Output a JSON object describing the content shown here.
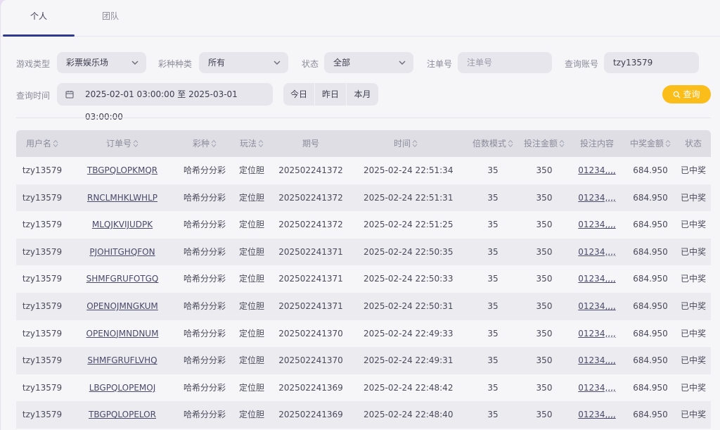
{
  "tabs": [
    {
      "label": "个人"
    },
    {
      "label": "团队"
    }
  ],
  "filters": {
    "game_type_label": "游戏类型",
    "game_type_value": "彩票娱乐场",
    "lottery_type_label": "彩种种类",
    "lottery_type_value": "所有",
    "status_label": "状态",
    "status_value": "全部",
    "order_label": "注单号",
    "order_placeholder": "注单号",
    "account_label": "查询账号",
    "account_value": "tzy13579",
    "time_label": "查询时间",
    "date_range": "2025-02-01 03:00:00 至 2025-03-01 03:00:00",
    "quick_ranges": [
      "今日",
      "昨日",
      "本月"
    ],
    "query_button": "查询"
  },
  "table": {
    "headers": [
      "用户名",
      "订单号",
      "彩种",
      "玩法",
      "期号",
      "时间",
      "倍数模式",
      "投注金额",
      "投注内容",
      "中奖金额",
      "状态"
    ],
    "rows": [
      [
        "tzy13579",
        "TBGPQLOPKMQR",
        "哈希分分彩",
        "定位胆",
        "202502241372",
        "2025-02-24 22:51:34",
        "35",
        "350",
        "01234,,,,",
        "684.950",
        "已中奖"
      ],
      [
        "tzy13579",
        "RNCLMHKLWHLP",
        "哈希分分彩",
        "定位胆",
        "202502241372",
        "2025-02-24 22:51:31",
        "35",
        "350",
        "01234,,,,",
        "684.950",
        "已中奖"
      ],
      [
        "tzy13579",
        "MLQJKVIJUDPK",
        "哈希分分彩",
        "定位胆",
        "202502241372",
        "2025-02-24 22:51:25",
        "35",
        "350",
        "01234,,,,",
        "684.950",
        "已中奖"
      ],
      [
        "tzy13579",
        "PJOHITGHQFON",
        "哈希分分彩",
        "定位胆",
        "202502241371",
        "2025-02-24 22:50:35",
        "35",
        "350",
        "01234,,,,",
        "684.950",
        "已中奖"
      ],
      [
        "tzy13579",
        "SHMFGRUFOTGQ",
        "哈希分分彩",
        "定位胆",
        "202502241371",
        "2025-02-24 22:50:33",
        "35",
        "350",
        "01234,,,,",
        "684.950",
        "已中奖"
      ],
      [
        "tzy13579",
        "OPENOJMNGKUM",
        "哈希分分彩",
        "定位胆",
        "202502241371",
        "2025-02-24 22:50:31",
        "35",
        "350",
        "01234,,,,",
        "684.950",
        "已中奖"
      ],
      [
        "tzy13579",
        "OPENOJMNDNUM",
        "哈希分分彩",
        "定位胆",
        "202502241370",
        "2025-02-24 22:49:33",
        "35",
        "350",
        "01234,,,,",
        "684.950",
        "已中奖"
      ],
      [
        "tzy13579",
        "SHMFGRUFLVHQ",
        "哈希分分彩",
        "定位胆",
        "202502241370",
        "2025-02-24 22:49:31",
        "35",
        "350",
        "01234,,,,",
        "684.950",
        "已中奖"
      ],
      [
        "tzy13579",
        "LBGPQLOPEMOJ",
        "哈希分分彩",
        "定位胆",
        "202502241369",
        "2025-02-24 22:48:42",
        "35",
        "350",
        "01234,,,,",
        "684.950",
        "已中奖"
      ],
      [
        "tzy13579",
        "TBGPQLOPELOR",
        "哈希分分彩",
        "定位胆",
        "202502241369",
        "2025-02-24 22:48:40",
        "35",
        "350",
        "01234,,,,",
        "684.950",
        "已中奖"
      ]
    ]
  },
  "colors": {
    "accent": "#2f3a8c",
    "query_button": "#fbbd1a"
  }
}
